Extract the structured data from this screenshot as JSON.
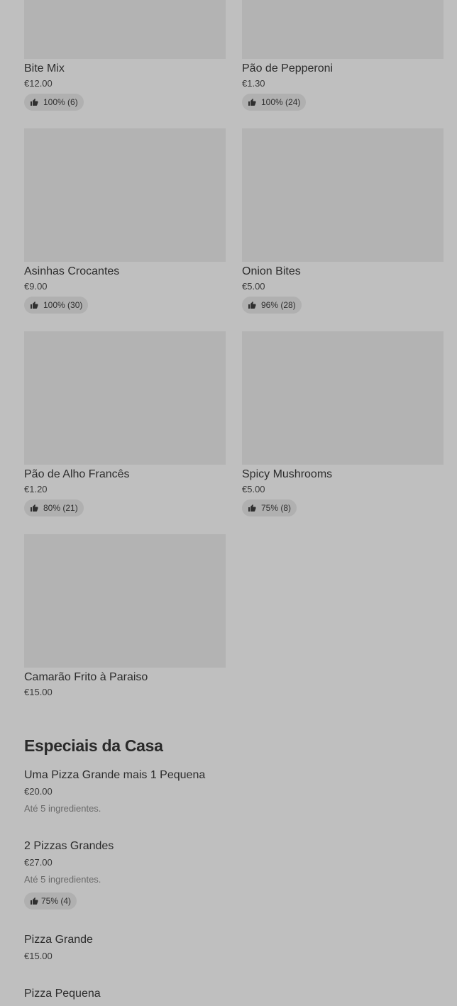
{
  "products": [
    {
      "name": "Bite Mix",
      "price": "€12.00",
      "rating": "100% (6)"
    },
    {
      "name": "Pão de Pepperoni",
      "price": "€1.30",
      "rating": "100% (24)"
    },
    {
      "name": "Asinhas Crocantes",
      "price": "€9.00",
      "rating": "100% (30)"
    },
    {
      "name": "Onion Bites",
      "price": "€5.00",
      "rating": "96% (28)"
    },
    {
      "name": "Pão de Alho Francês",
      "price": "€1.20",
      "rating": "80% (21)"
    },
    {
      "name": "Spicy Mushrooms",
      "price": "€5.00",
      "rating": "75% (8)"
    },
    {
      "name": "Camarão Frito à Paraiso",
      "price": "€15.00"
    }
  ],
  "section": {
    "title": "Especiais da Casa",
    "items": [
      {
        "name": "Uma Pizza Grande mais 1 Pequena",
        "price": "€20.00",
        "description": "Até 5 ingredientes."
      },
      {
        "name": "2 Pizzas Grandes",
        "price": "€27.00",
        "description": "Até 5 ingredientes.",
        "rating": "75% (4)"
      },
      {
        "name": "Pizza Grande",
        "price": "€15.00"
      },
      {
        "name": "Pizza Pequena"
      }
    ]
  },
  "icons": {
    "rating": "thumbs-up-icon"
  },
  "colors": {
    "background": "#bfbfbf",
    "image_placeholder": "#b3b3b3",
    "badge": "#b0b0b0"
  }
}
